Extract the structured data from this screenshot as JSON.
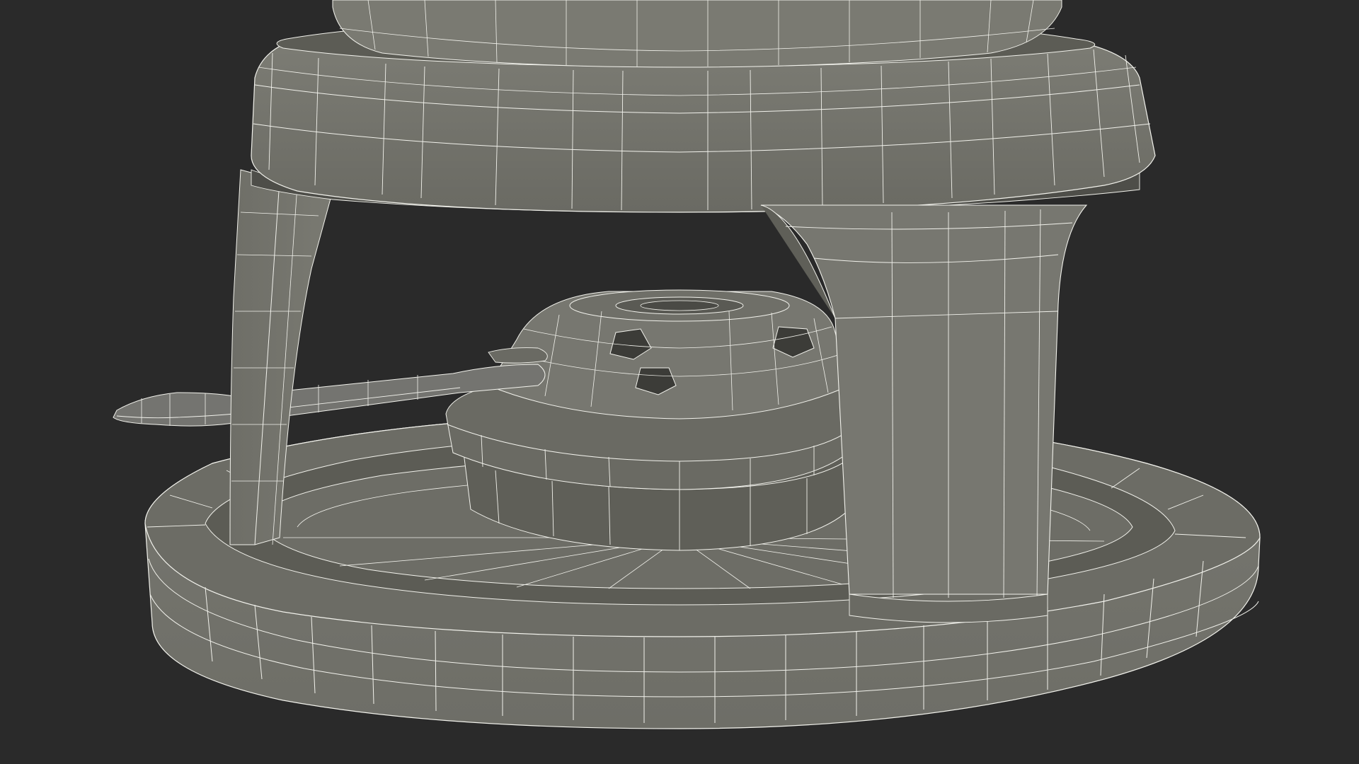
{
  "scene": {
    "subject": "fondue-set-wireframe-render",
    "background_color": "#2a2a2a",
    "mesh_fill_color": "#787870",
    "mesh_shadow_color": "#5e5e57",
    "mesh_dark_color": "#4c4c47",
    "wire_color": "#f2f2ec"
  }
}
